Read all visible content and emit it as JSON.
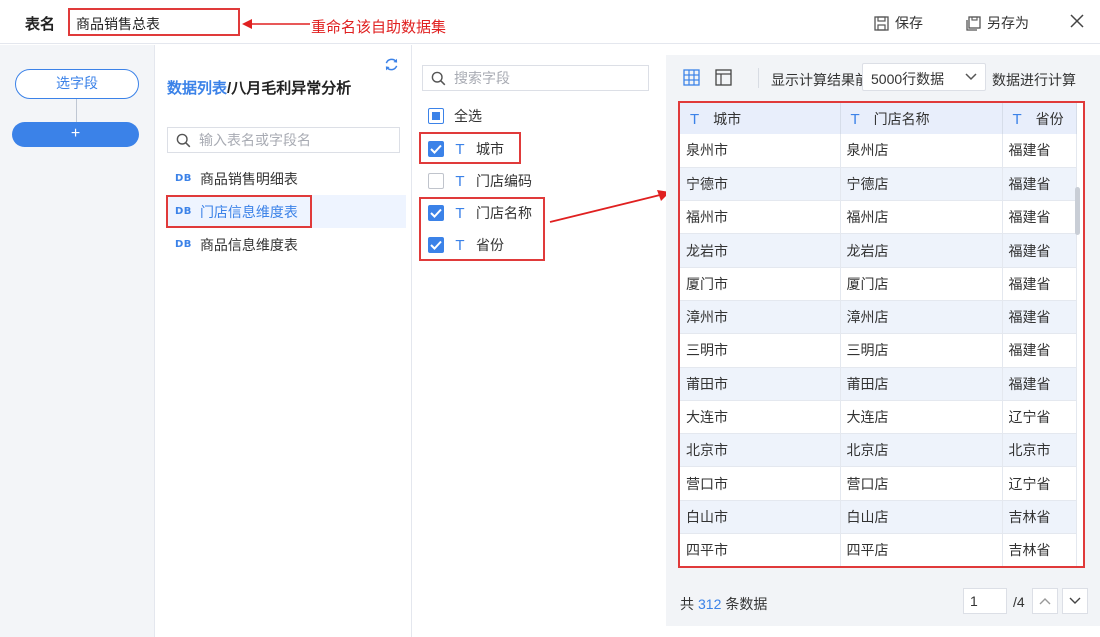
{
  "header": {
    "table_name_label": "表名",
    "table_name_value": "商品销售总表",
    "annotation": "重命名该自助数据集",
    "save_label": "保存",
    "save_as_label": "另存为"
  },
  "steps": {
    "select_fields_label": "选字段",
    "add_label": "+"
  },
  "tables_panel": {
    "title_link": "数据列表",
    "title_separator": "/",
    "title_name": "八月毛利异常分析",
    "search_placeholder": "输入表名或字段名",
    "db_badge": "DB",
    "items": [
      {
        "label": "商品销售明细表"
      },
      {
        "label": "门店信息维度表"
      },
      {
        "label": "商品信息维度表"
      }
    ]
  },
  "fields_panel": {
    "search_placeholder": "搜索字段",
    "select_all_label": "全选",
    "type_glyph": "T",
    "fields": [
      {
        "label": "城市",
        "checked": true
      },
      {
        "label": "门店编码",
        "checked": false
      },
      {
        "label": "门店名称",
        "checked": true
      },
      {
        "label": "省份",
        "checked": true
      }
    ]
  },
  "preview": {
    "show_result_label": "显示计算结果前",
    "select_value": "5000行数据",
    "compute_label": "数据进行计算",
    "columns": [
      "城市",
      "门店名称",
      "省份"
    ],
    "rows": [
      [
        "泉州市",
        "泉州店",
        "福建省"
      ],
      [
        "宁德市",
        "宁德店",
        "福建省"
      ],
      [
        "福州市",
        "福州店",
        "福建省"
      ],
      [
        "龙岩市",
        "龙岩店",
        "福建省"
      ],
      [
        "厦门市",
        "厦门店",
        "福建省"
      ],
      [
        "漳州市",
        "漳州店",
        "福建省"
      ],
      [
        "三明市",
        "三明店",
        "福建省"
      ],
      [
        "莆田市",
        "莆田店",
        "福建省"
      ],
      [
        "大连市",
        "大连店",
        "辽宁省"
      ],
      [
        "北京市",
        "北京店",
        "北京市"
      ],
      [
        "营口市",
        "营口店",
        "辽宁省"
      ],
      [
        "白山市",
        "白山店",
        "吉林省"
      ],
      [
        "四平市",
        "四平店",
        "吉林省"
      ]
    ],
    "footer_prefix": "共",
    "total_count": "312",
    "footer_suffix": "条数据",
    "page_value": "1",
    "page_total": "/4"
  },
  "colors": {
    "accent": "#3b82e8",
    "annotation_red": "#e03a3a",
    "header_bg": "#e8eefb",
    "alt_row_bg": "#eef3fb"
  },
  "icons": [
    "save-icon",
    "save-as-icon",
    "close-icon",
    "refresh-icon",
    "search-icon",
    "grid-view-icon",
    "layout-view-icon",
    "chevron-down-icon",
    "chevron-up-icon"
  ]
}
